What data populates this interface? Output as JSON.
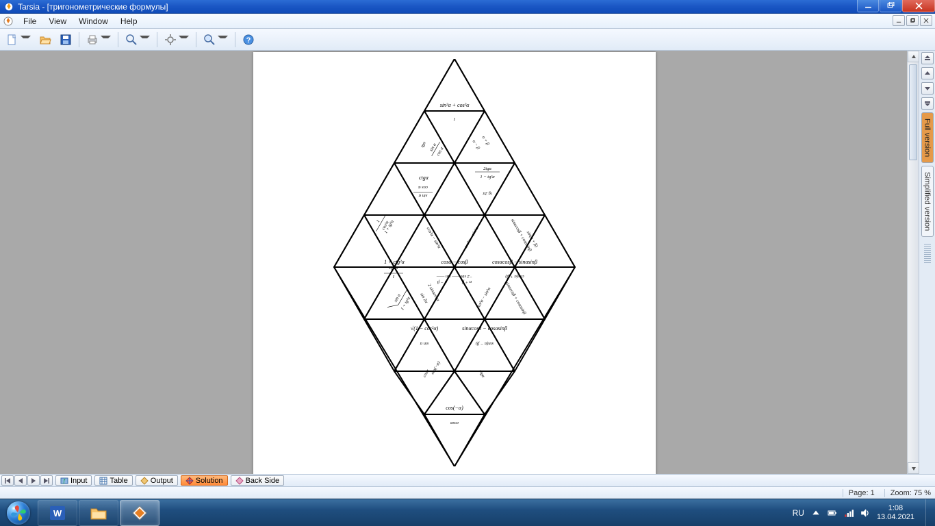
{
  "window": {
    "title": "Tarsia - [тригонометрические формулы]"
  },
  "menu": {
    "file": "File",
    "view": "View",
    "window": "Window",
    "help": "Help"
  },
  "side_tabs": {
    "full": "Full version",
    "simplified": "Simplified version"
  },
  "bottom_tabs": {
    "input": "Input",
    "table": "Table",
    "output": "Output",
    "solution": "Solution",
    "back_side": "Back Side"
  },
  "status": {
    "page_label": "Page: 1",
    "zoom_label": "Zoom: 75 %"
  },
  "tray": {
    "lang": "RU",
    "time": "1:08",
    "date": "13.04.2021"
  },
  "formulas": {
    "f1": "sin²α + cos²α",
    "f2": "1",
    "f3": "ctgα",
    "f4": "2tgα",
    "f5": "1 − tg²α",
    "f6": "tg 2α",
    "f7": "1 + ctg²α",
    "f8": "cosα − cosβ",
    "f9": "cosαcosβ − sinαsinβ",
    "f10": "cos(α + β)",
    "f11": "√(1 − cos²α)",
    "f12": "sinαcosβ − cosαsinβ",
    "f13": "sin α",
    "f14": "sin(α − β)",
    "f15": "cos(−α)",
    "f16": "cosα",
    "f17": "cos α",
    "f18": "sin α",
    "f19": "sin²α",
    "f20": "2 sinαcosα",
    "f21": "sin 2α",
    "f22": "1",
    "f23": "sin²α",
    "f24": "α + β",
    "f25": "α − β",
    "f26": "−2 sin —— sin ——",
    "f27": "cos²α − sin²α",
    "f28": "tgα",
    "f29": "1 + tg²α",
    "f30": "1",
    "f31": "cos²α",
    "f32": "sinαcosβ + cosαsinβ",
    "f33": "sin(α + β)",
    "f34": "cosα",
    "f35": "cos(−α)",
    "f36": "−tgα"
  }
}
